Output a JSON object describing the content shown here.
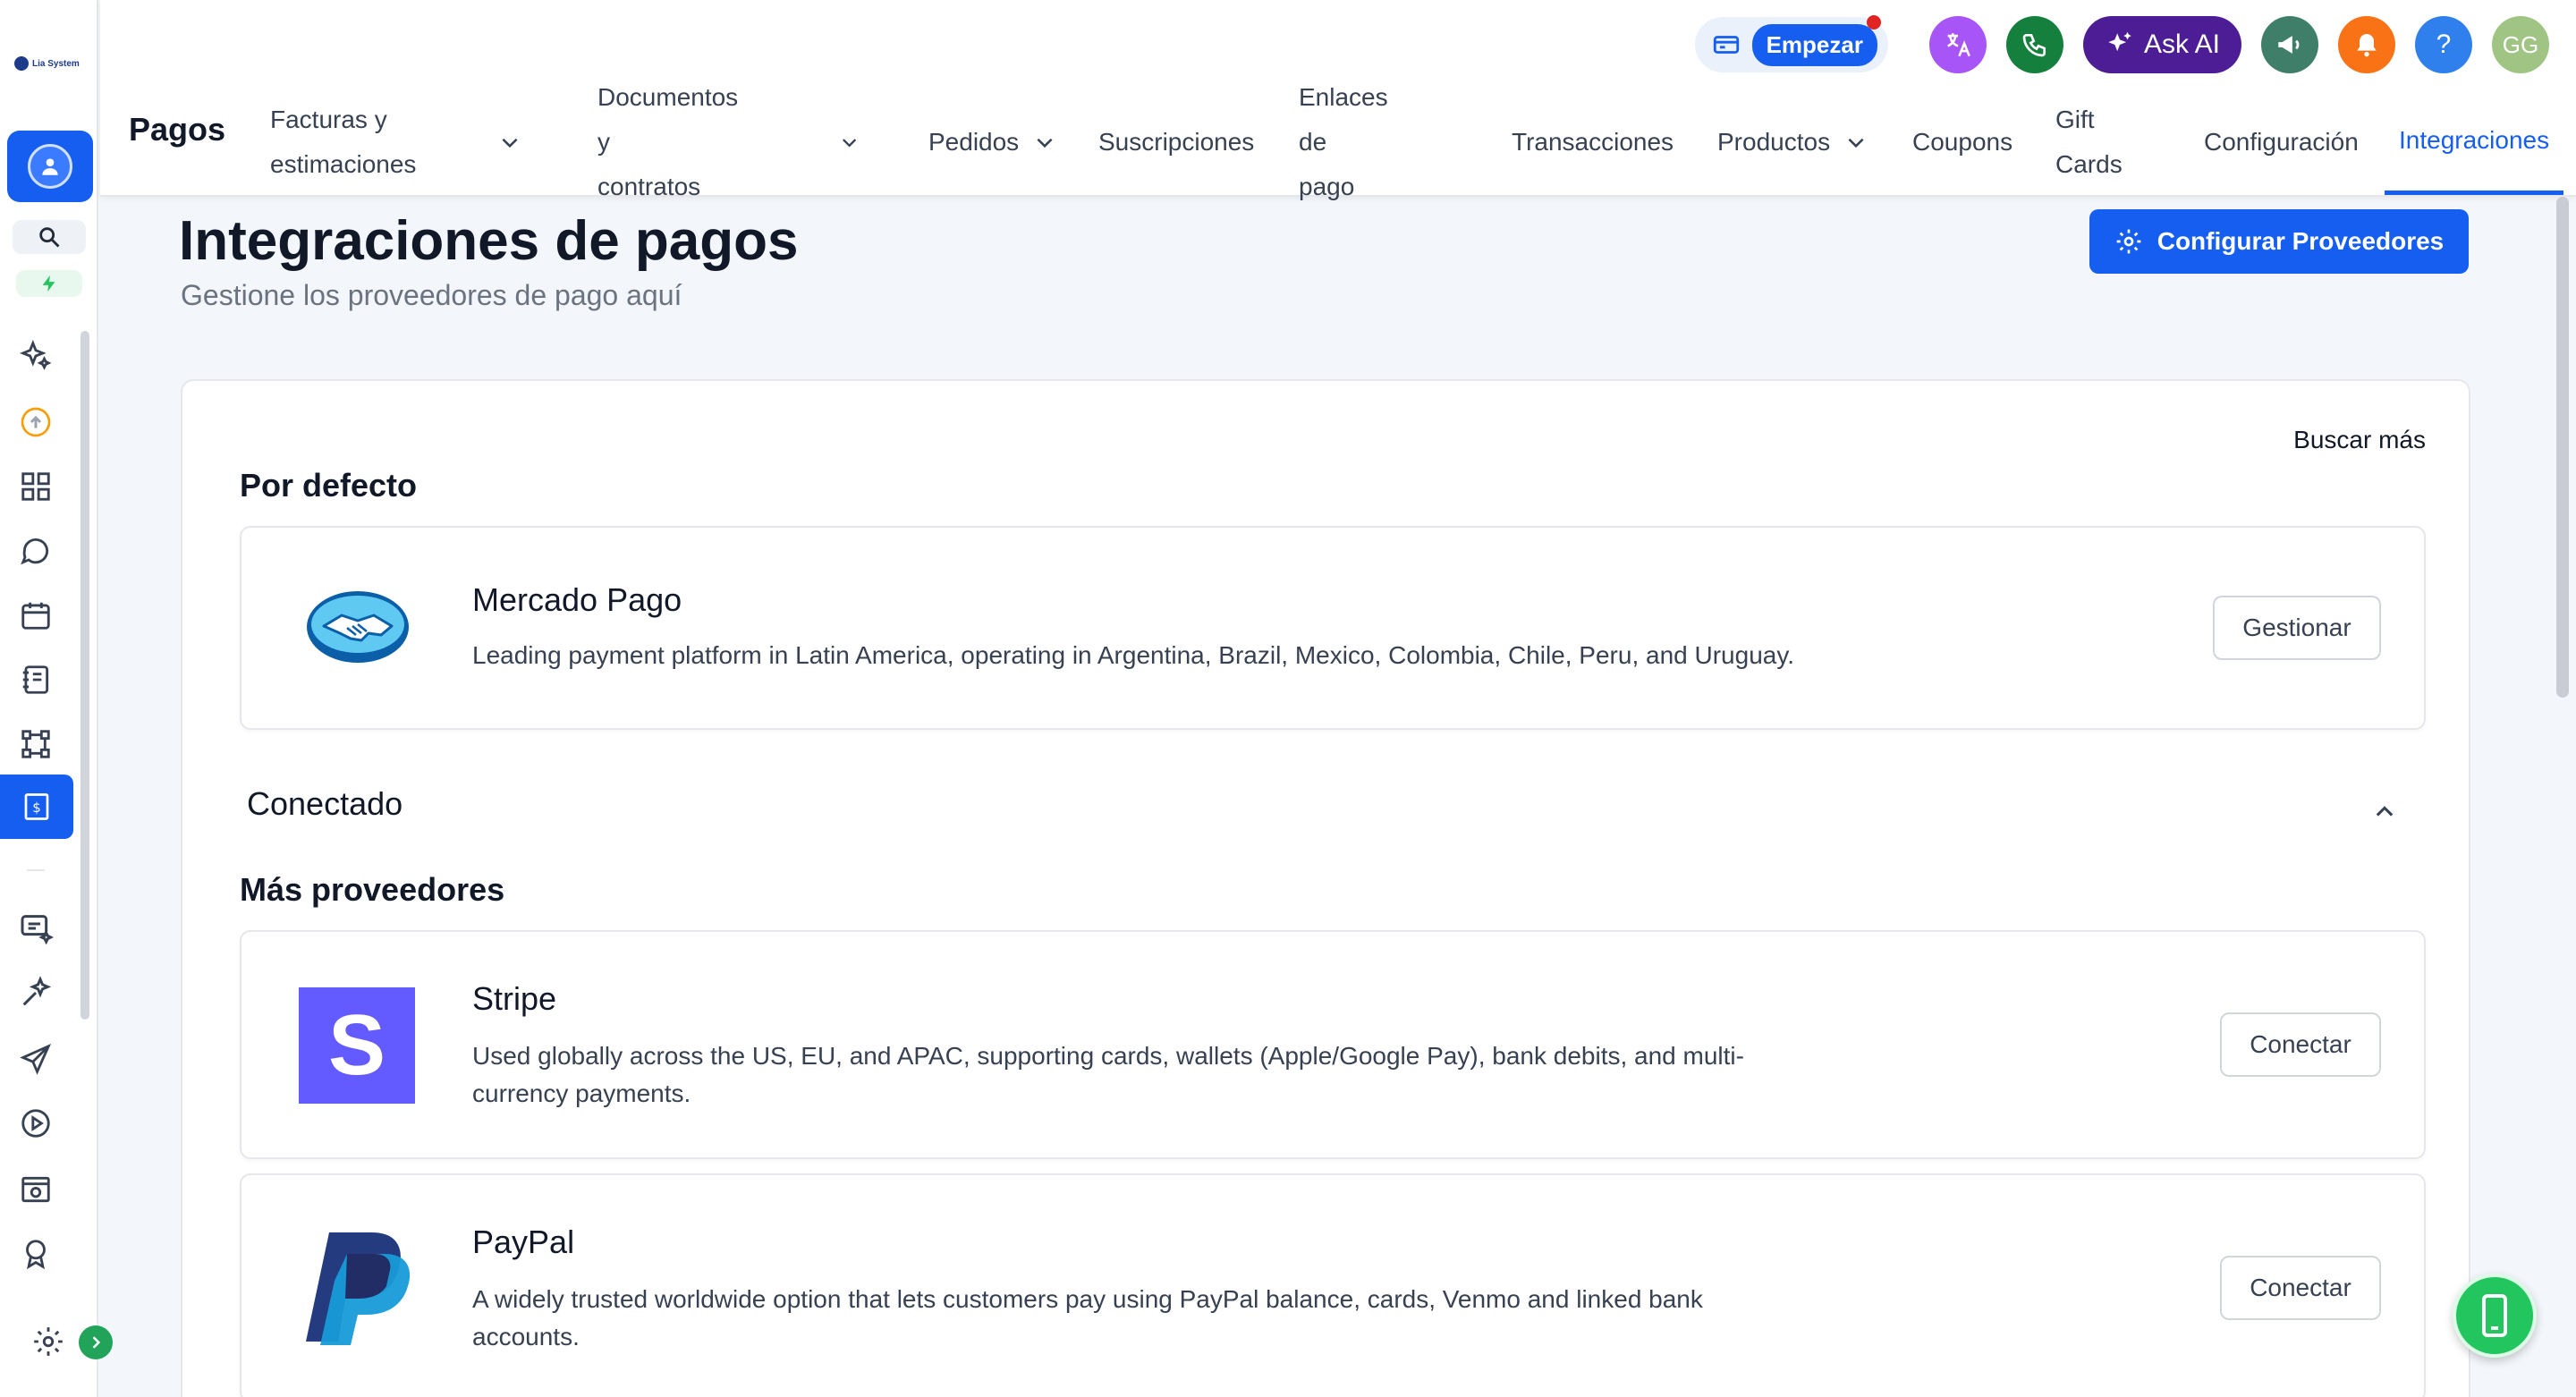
{
  "brand": {
    "logo_text": "Lia System"
  },
  "topbar": {
    "start_label": "Empezar",
    "ask_ai_label": "Ask AI",
    "help_label": "?",
    "avatar_initials": "GG"
  },
  "section_title": "Pagos",
  "nav": [
    {
      "label": "Facturas y\nestimaciones",
      "dropdown": true
    },
    {
      "label": "Documentos y\ncontratos",
      "dropdown": true
    },
    {
      "label": "Pedidos",
      "dropdown": true
    },
    {
      "label": "Suscripciones",
      "dropdown": false
    },
    {
      "label": "Enlaces de\npago",
      "dropdown": false
    },
    {
      "label": "Transacciones",
      "dropdown": false
    },
    {
      "label": "Productos",
      "dropdown": true
    },
    {
      "label": "Coupons",
      "dropdown": false
    },
    {
      "label": "Gift\nCards",
      "dropdown": false
    },
    {
      "label": "Configuración",
      "dropdown": false
    },
    {
      "label": "Integraciones",
      "dropdown": false,
      "active": true
    }
  ],
  "page": {
    "title": "Integraciones de pagos",
    "subtitle": "Gestione los proveedores de pago aquí",
    "config_button": "Configurar Proveedores",
    "search_more": "Buscar más"
  },
  "sections": {
    "default_title": "Por defecto",
    "connected_title": "Conectado",
    "more_title": "Más proveedores"
  },
  "providers": {
    "mercado_pago": {
      "name": "Mercado Pago",
      "description": "Leading payment platform in Latin America, operating in Argentina, Brazil, Mexico, Colombia, Chile, Peru, and Uruguay.",
      "action": "Gestionar"
    },
    "stripe": {
      "name": "Stripe",
      "description": "Used globally across the US, EU, and APAC, supporting cards, wallets (Apple/Google Pay), bank debits, and multi-currency payments.",
      "action": "Conectar",
      "logo_letter": "S"
    },
    "paypal": {
      "name": "PayPal",
      "description": "A widely trusted worldwide option that lets customers pay using PayPal balance, cards, Venmo and linked bank accounts.",
      "action": "Conectar"
    }
  },
  "colors": {
    "primary": "#155eef",
    "sidebar_active": "#155eef",
    "ask_ai": "#4c1d95",
    "phone": "#15803d",
    "megaphone": "#3f7f6a",
    "bell": "#f97316",
    "help": "#2f80ed",
    "translate": "#a855f7",
    "stripe": "#635bff",
    "paypal_dark": "#253b80",
    "paypal_light": "#179bd7"
  },
  "icons": {
    "sidebar": [
      "sparkles-icon",
      "upload-cloud-icon",
      "dashboard-grid-icon",
      "chat-icon",
      "calendar-icon",
      "contacts-book-icon",
      "workflow-icon",
      "payments-icon",
      "marketing-icon",
      "ai-agents-icon",
      "send-icon",
      "video-icon",
      "website-icon",
      "reputation-icon"
    ]
  }
}
